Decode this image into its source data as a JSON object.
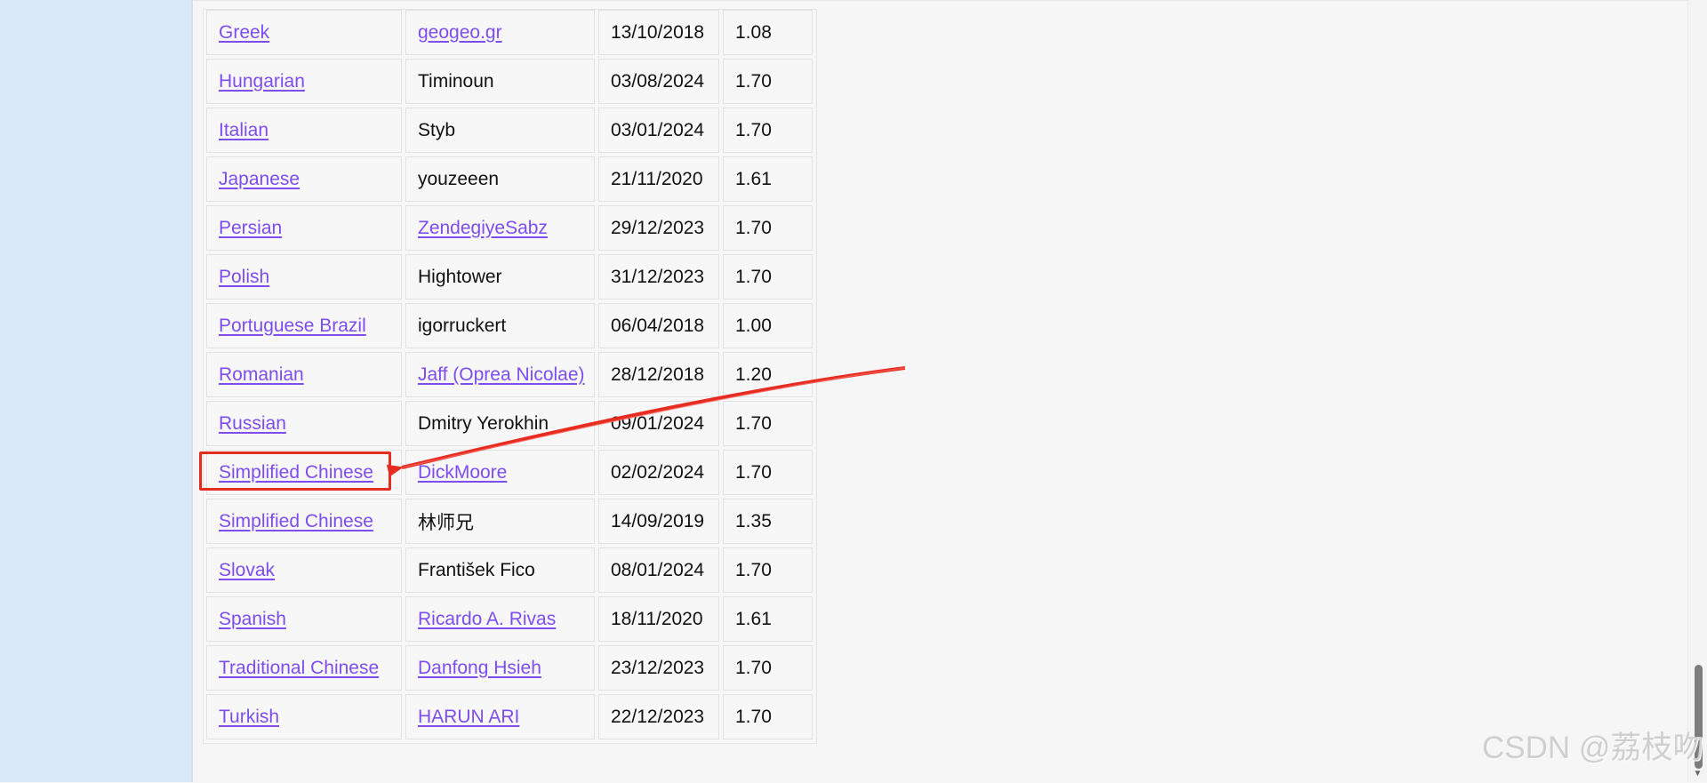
{
  "rows": [
    {
      "language": "Greek",
      "translator": "geogeo.gr",
      "date": "13/10/2018",
      "version": "1.08",
      "translator_is_link": true
    },
    {
      "language": "Hungarian",
      "translator": "Timinoun",
      "date": "03/08/2024",
      "version": "1.70",
      "translator_is_link": false
    },
    {
      "language": "Italian",
      "translator": "Styb",
      "date": "03/01/2024",
      "version": "1.70",
      "translator_is_link": false
    },
    {
      "language": "Japanese",
      "translator": "youzeeen",
      "date": "21/11/2020",
      "version": "1.61",
      "translator_is_link": false
    },
    {
      "language": "Persian",
      "translator": "ZendegiyeSabz",
      "date": "29/12/2023",
      "version": "1.70",
      "translator_is_link": true
    },
    {
      "language": "Polish",
      "translator": "Hightower",
      "date": "31/12/2023",
      "version": "1.70",
      "translator_is_link": false
    },
    {
      "language": "Portuguese Brazil",
      "translator": "igorruckert",
      "date": "06/04/2018",
      "version": "1.00",
      "translator_is_link": false
    },
    {
      "language": "Romanian",
      "translator": "Jaff (Oprea Nicolae)",
      "date": "28/12/2018",
      "version": "1.20",
      "translator_is_link": true
    },
    {
      "language": "Russian",
      "translator": "Dmitry Yerokhin",
      "date": "09/01/2024",
      "version": "1.70",
      "translator_is_link": false
    },
    {
      "language": "Simplified Chinese",
      "translator": "DickMoore",
      "date": "02/02/2024",
      "version": "1.70",
      "translator_is_link": true,
      "highlighted": true
    },
    {
      "language": "Simplified Chinese",
      "translator": "林师兄",
      "date": "14/09/2019",
      "version": "1.35",
      "translator_is_link": false
    },
    {
      "language": "Slovak",
      "translator": "František Fico",
      "date": "08/01/2024",
      "version": "1.70",
      "translator_is_link": false
    },
    {
      "language": "Spanish",
      "translator": "Ricardo A. Rivas",
      "date": "18/11/2020",
      "version": "1.61",
      "translator_is_link": true
    },
    {
      "language": "Traditional Chinese",
      "translator": "Danfong Hsieh",
      "date": "23/12/2023",
      "version": "1.70",
      "translator_is_link": true
    },
    {
      "language": "Turkish",
      "translator": "HARUN ARI",
      "date": "22/12/2023",
      "version": "1.70",
      "translator_is_link": true
    }
  ],
  "annotation": {
    "color": "#e62b20",
    "icon": "arrow-icon"
  },
  "watermark": "CSDN @荔枝吻",
  "colors": {
    "sidebar": "#d9e9f8",
    "page": "#f6f6f6",
    "link": "#7d4df0",
    "annotation": "#e62b20"
  }
}
